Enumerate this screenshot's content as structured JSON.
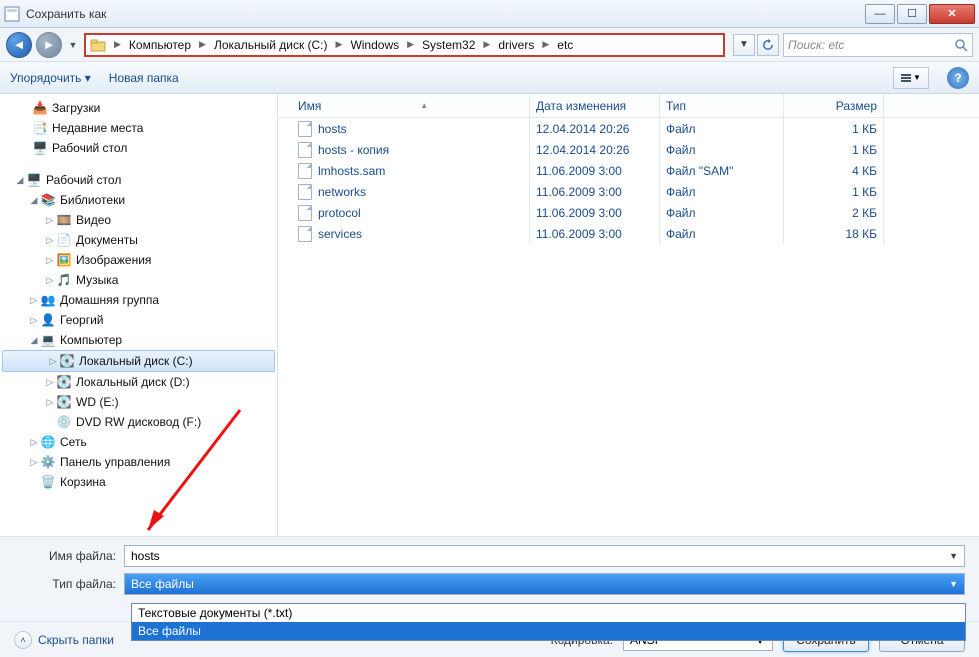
{
  "window": {
    "title": "Сохранить как"
  },
  "breadcrumb": [
    "Компьютер",
    "Локальный диск (C:)",
    "Windows",
    "System32",
    "drivers",
    "etc"
  ],
  "search": {
    "placeholder": "Поиск: etc"
  },
  "toolbar": {
    "organize": "Упорядочить",
    "newfolder": "Новая папка"
  },
  "columns": {
    "name": "Имя",
    "date": "Дата изменения",
    "type": "Тип",
    "size": "Размер"
  },
  "tree": {
    "downloads": "Загрузки",
    "recent": "Недавние места",
    "desktop_fav": "Рабочий стол",
    "desktop": "Рабочий стол",
    "libraries": "Библиотеки",
    "video": "Видео",
    "documents": "Документы",
    "images": "Изображения",
    "music": "Музыка",
    "homegroup": "Домашняя группа",
    "user": "Георгий",
    "computer": "Компьютер",
    "disk_c": "Локальный диск (C:)",
    "disk_d": "Локальный диск (D:)",
    "disk_e": "WD (E:)",
    "disk_f": "DVD RW дисковод (F:)",
    "network": "Сеть",
    "controlpanel": "Панель управления",
    "recycle": "Корзина"
  },
  "files": [
    {
      "name": "hosts",
      "date": "12.04.2014 20:26",
      "type": "Файл",
      "size": "1 КБ"
    },
    {
      "name": "hosts - копия",
      "date": "12.04.2014 20:26",
      "type": "Файл",
      "size": "1 КБ"
    },
    {
      "name": "lmhosts.sam",
      "date": "11.06.2009 3:00",
      "type": "Файл \"SAM\"",
      "size": "4 КБ"
    },
    {
      "name": "networks",
      "date": "11.06.2009 3:00",
      "type": "Файл",
      "size": "1 КБ"
    },
    {
      "name": "protocol",
      "date": "11.06.2009 3:00",
      "type": "Файл",
      "size": "2 КБ"
    },
    {
      "name": "services",
      "date": "11.06.2009 3:00",
      "type": "Файл",
      "size": "18 КБ"
    }
  ],
  "form": {
    "name_label": "Имя файла:",
    "name_value": "hosts",
    "type_label": "Тип файла:",
    "type_value": "Все файлы",
    "type_options": [
      "Текстовые документы (*.txt)",
      "Все файлы"
    ]
  },
  "footer": {
    "hide": "Скрыть папки",
    "encoding_label": "Кодировка:",
    "encoding_value": "ANSI",
    "save": "Сохранить",
    "cancel": "Отмена"
  }
}
